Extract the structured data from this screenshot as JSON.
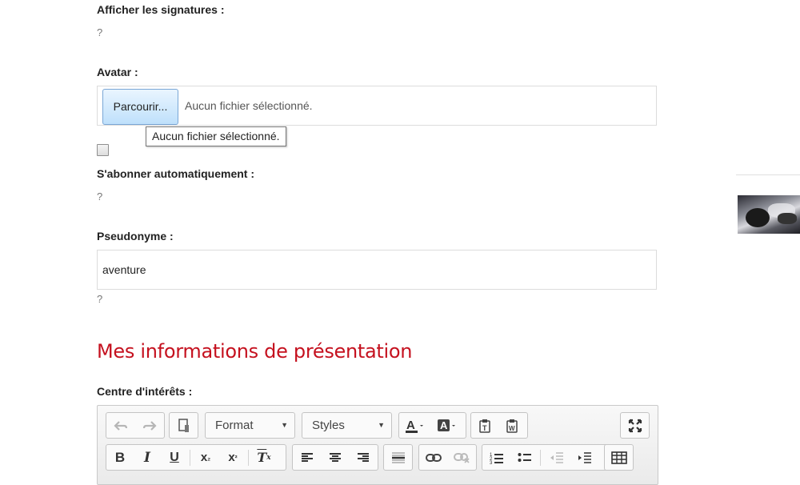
{
  "form": {
    "signatures": {
      "label": "Afficher les signatures :",
      "hint": "?"
    },
    "avatar": {
      "label": "Avatar :",
      "browse_label": "Parcourir...",
      "file_status": "Aucun fichier sélectionné.",
      "tooltip": "Aucun fichier sélectionné."
    },
    "subscribe": {
      "label": "S'abonner automatiquement :",
      "hint": "?",
      "checked": false
    },
    "nickname": {
      "label": "Pseudonyme :",
      "value": "aventure",
      "hint": "?"
    }
  },
  "section": {
    "title": "Mes informations de présentation"
  },
  "interests": {
    "label": "Centre d'intérêts :"
  },
  "editor": {
    "format_label": "Format",
    "styles_label": "Styles",
    "icons": [
      "undo-icon",
      "redo-icon",
      "source-icon",
      "text-color-icon",
      "background-color-icon",
      "paste-text-icon",
      "paste-word-icon",
      "maximize-icon",
      "bold-icon",
      "italic-icon",
      "underline-icon",
      "subscript-icon",
      "superscript-icon",
      "remove-format-icon",
      "align-left-icon",
      "align-center-icon",
      "align-right-icon",
      "horizontal-rule-icon",
      "link-icon",
      "unlink-icon",
      "numbered-list-icon",
      "bulleted-list-icon",
      "outdent-icon",
      "indent-icon",
      "table-icon"
    ]
  },
  "colors": {
    "title_red": "#c5111f",
    "field_border": "#dcdcdc"
  }
}
